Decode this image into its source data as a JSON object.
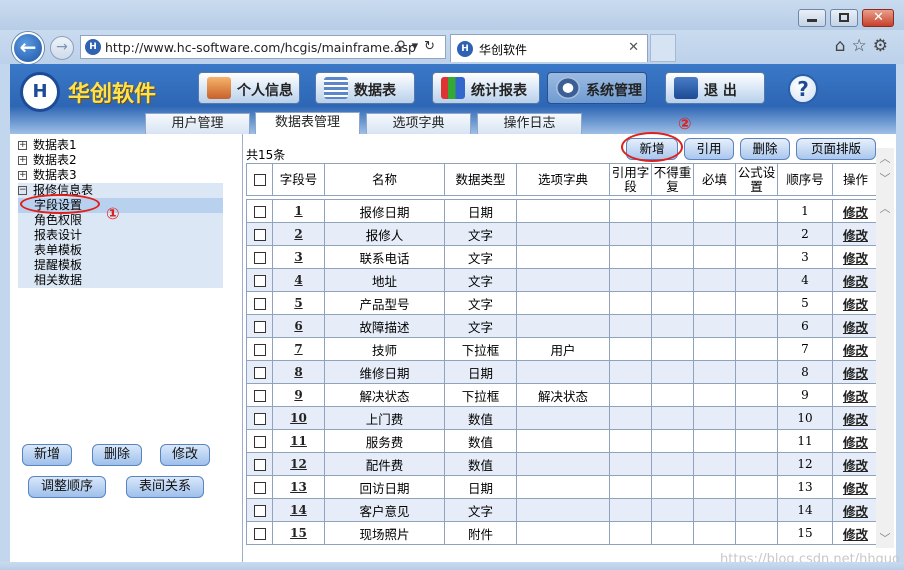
{
  "browser": {
    "url": "http://www.hc-software.com/hcgis/mainframe.asp",
    "tab_title": "华创软件",
    "favicon_text": "H"
  },
  "app": {
    "brand": "华创软件",
    "nav": [
      {
        "label": "个人信息"
      },
      {
        "label": "数据表"
      },
      {
        "label": "统计报表"
      },
      {
        "label": "系统管理"
      },
      {
        "label": "退 出"
      }
    ],
    "help": "?",
    "subtabs": [
      "用户管理",
      "数据表管理",
      "选项字典",
      "操作日志"
    ]
  },
  "tree": {
    "nodes": [
      {
        "label": "数据表1",
        "box": "+"
      },
      {
        "label": "数据表2",
        "box": "+"
      },
      {
        "label": "数据表3",
        "box": "+"
      },
      {
        "label": "报修信息表",
        "box": "−"
      }
    ],
    "children": [
      "字段设置",
      "角色权限",
      "报表设计",
      "表单模板",
      "提醒模板",
      "相关数据"
    ]
  },
  "left_buttons": {
    "add": "新增",
    "delete": "删除",
    "edit": "修改",
    "reorder": "调整顺序",
    "relations": "表间关系"
  },
  "grid": {
    "count": "共15条",
    "actions": {
      "add": "新增",
      "reference": "引用",
      "delete": "删除",
      "layout": "页面排版"
    },
    "headers": [
      "字段号",
      "名称",
      "数据类型",
      "选项字典",
      "引用字段",
      "不得重复",
      "必填",
      "公式设置",
      "顺序号",
      "操作"
    ],
    "rows": [
      {
        "id": "1",
        "name": "报修日期",
        "type": "日期",
        "dict": "",
        "order": "1",
        "op": "修改"
      },
      {
        "id": "2",
        "name": "报修人",
        "type": "文字",
        "dict": "",
        "order": "2",
        "op": "修改"
      },
      {
        "id": "3",
        "name": "联系电话",
        "type": "文字",
        "dict": "",
        "order": "3",
        "op": "修改"
      },
      {
        "id": "4",
        "name": "地址",
        "type": "文字",
        "dict": "",
        "order": "4",
        "op": "修改"
      },
      {
        "id": "5",
        "name": "产品型号",
        "type": "文字",
        "dict": "",
        "order": "5",
        "op": "修改"
      },
      {
        "id": "6",
        "name": "故障描述",
        "type": "文字",
        "dict": "",
        "order": "6",
        "op": "修改"
      },
      {
        "id": "7",
        "name": "技师",
        "type": "下拉框",
        "dict": "用户",
        "order": "7",
        "op": "修改"
      },
      {
        "id": "8",
        "name": "维修日期",
        "type": "日期",
        "dict": "",
        "order": "8",
        "op": "修改"
      },
      {
        "id": "9",
        "name": "解决状态",
        "type": "下拉框",
        "dict": "解决状态",
        "order": "9",
        "op": "修改"
      },
      {
        "id": "10",
        "name": "上门费",
        "type": "数值",
        "dict": "",
        "order": "10",
        "op": "修改"
      },
      {
        "id": "11",
        "name": "服务费",
        "type": "数值",
        "dict": "",
        "order": "11",
        "op": "修改"
      },
      {
        "id": "12",
        "name": "配件费",
        "type": "数值",
        "dict": "",
        "order": "12",
        "op": "修改"
      },
      {
        "id": "13",
        "name": "回访日期",
        "type": "日期",
        "dict": "",
        "order": "13",
        "op": "修改"
      },
      {
        "id": "14",
        "name": "客户意见",
        "type": "文字",
        "dict": "",
        "order": "14",
        "op": "修改"
      },
      {
        "id": "15",
        "name": "现场照片",
        "type": "附件",
        "dict": "",
        "order": "15",
        "op": "修改"
      }
    ]
  },
  "annotations": {
    "one": "①",
    "two": "②"
  },
  "watermark": "https://blog.csdn.net/hhguo"
}
